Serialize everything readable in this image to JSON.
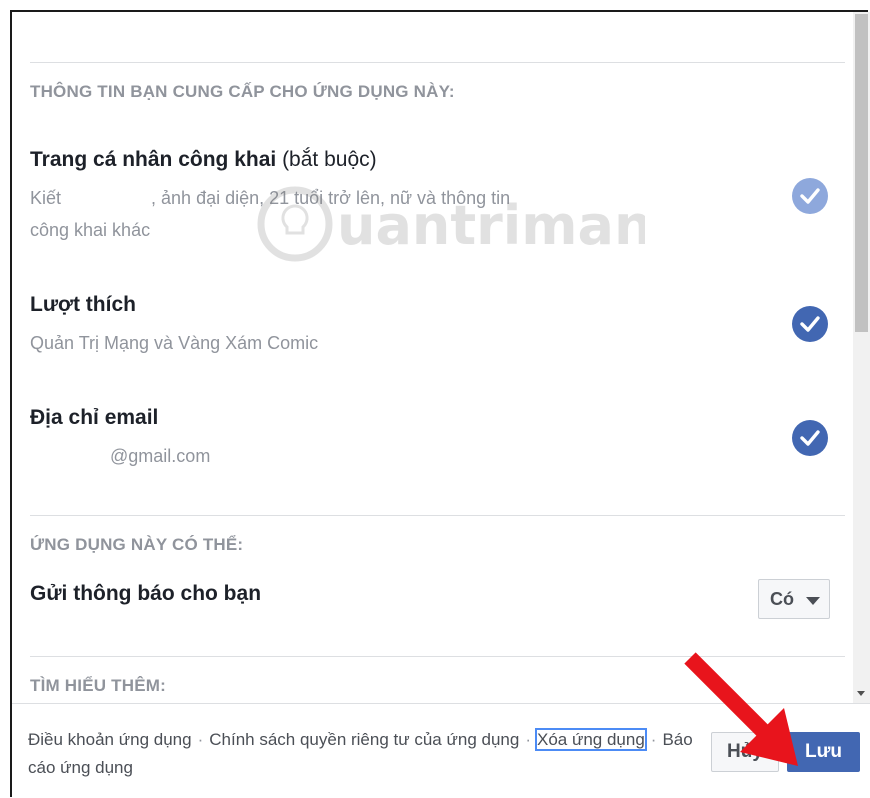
{
  "sections": {
    "provided_info": {
      "heading": "THÔNG TIN BẠN CUNG CẤP CHO ỨNG DỤNG NÀY:",
      "items": [
        {
          "title": "Trang cá nhân công khai",
          "title_suffix": "(bắt buộc)",
          "sub_line1": "Kiết                  , ảnh đại diện, 21 tuổi trở lên, nữ và thông tin",
          "sub_line2": "công khai khác",
          "checked": true,
          "check_style": "faded"
        },
        {
          "title": "Lượt thích",
          "sub_line1": "Quản Trị Mạng và Vàng Xám Comic",
          "checked": true
        },
        {
          "title": "Địa chỉ email",
          "sub_line1": "                @gmail.com",
          "checked": true
        }
      ]
    },
    "app_can": {
      "heading": "ỨNG DỤNG NÀY CÓ THỂ:",
      "items": [
        {
          "title": "Gửi thông báo cho bạn",
          "select_value": "Có"
        }
      ]
    },
    "learn_more": {
      "heading": "TÌM HIỂU THÊM:"
    }
  },
  "watermark_text": "uantrimang",
  "footer": {
    "links": [
      "Điều khoản ứng dụng",
      "Chính sách quyền riêng tư của ứng dụng",
      "Xóa ứng dụng",
      "Báo cáo ứng dụng"
    ],
    "separator": "·",
    "cancel_label": "Hủy",
    "save_label": "Lưu"
  },
  "colors": {
    "accent": "#4267b2",
    "muted_text": "#90949c",
    "annotation_arrow": "#e8141c"
  }
}
